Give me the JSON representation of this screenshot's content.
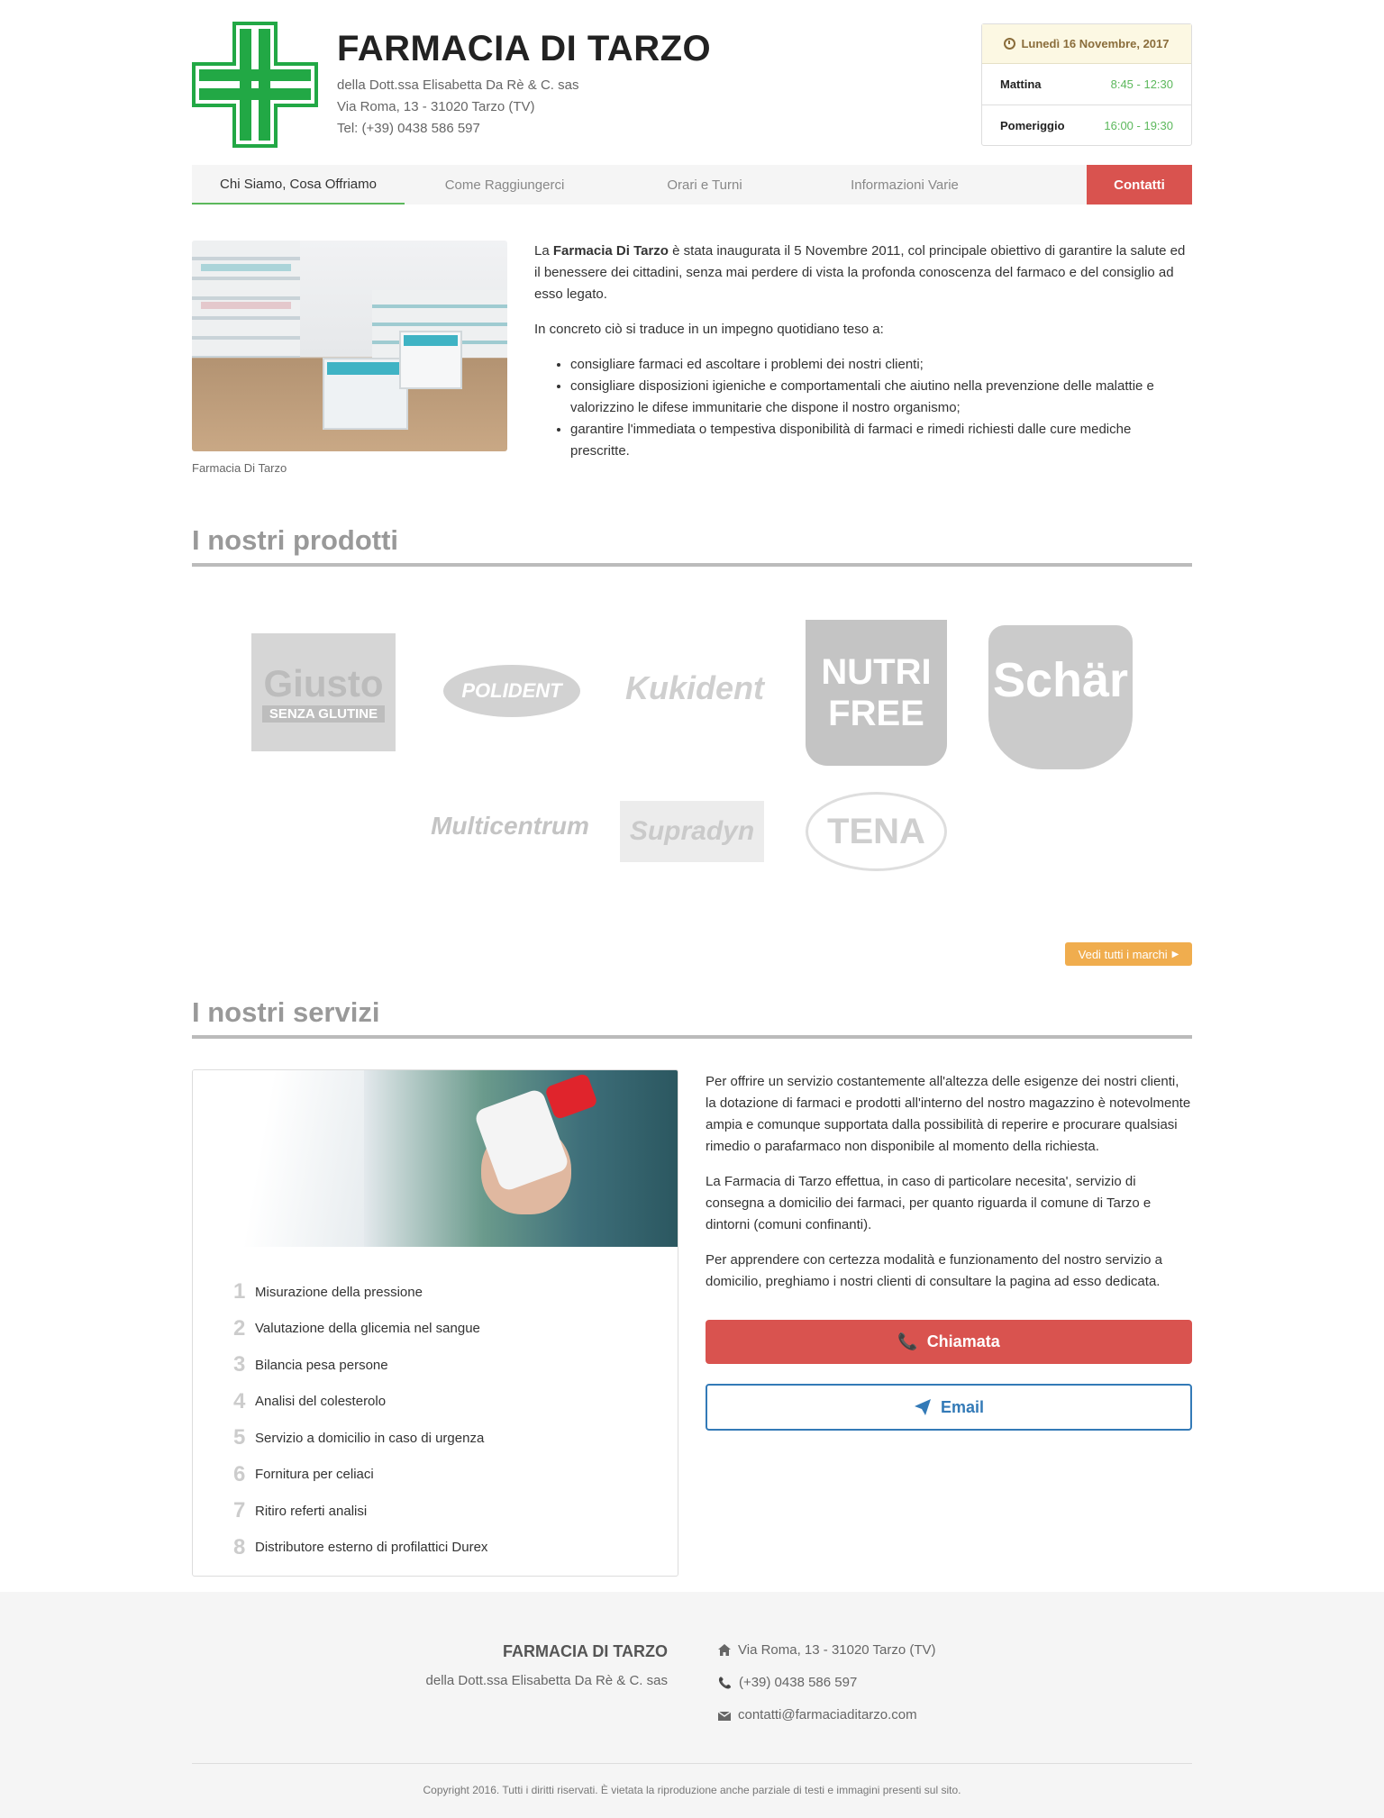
{
  "header": {
    "title": "FARMACIA DI TARZO",
    "subtitle": "della Dott.ssa Elisabetta Da Rè & C. sas",
    "address": "Via Roma, 13 - 31020 Tarzo (TV)",
    "phone": "Tel: (+39) 0438 586 597",
    "accent_color": "#22a845"
  },
  "hours": {
    "date": "Lunedì 16 Novembre, 2017",
    "rows": [
      {
        "label": "Mattina",
        "value": "8:45 - 12:30"
      },
      {
        "label": "Pomeriggio",
        "value": "16:00 - 19:30"
      }
    ]
  },
  "nav": {
    "items": [
      {
        "label": "Chi Siamo, Cosa Offriamo"
      },
      {
        "label": "Come Raggiungerci"
      },
      {
        "label": "Orari e Turni"
      },
      {
        "label": "Informazioni Varie"
      }
    ],
    "cta": "Contatti"
  },
  "intro": {
    "caption": "Farmacia Di Tarzo",
    "p1_pre": "La ",
    "p1_bold": "Farmacia Di Tarzo",
    "p1_post": " è stata inaugurata il 5 Novembre 2011, col principale obiettivo di garantire la salute ed il benessere dei cittadini, senza mai perdere di vista la profonda conoscenza del farmaco e del consiglio ad esso legato.",
    "p2": "In concreto ciò si traduce in un impegno quotidiano teso a:",
    "bullets": [
      "consigliare farmaci ed ascoltare i problemi dei nostri clienti;",
      "consigliare disposizioni igieniche e comportamentali che aiutino nella prevenzione delle malattie e valorizzino le difese immunitarie che dispone il nostro organismo;",
      "garantire l'immediata o tempestiva disponibilità di farmaci e rimedi richiesti dalle cure mediche prescritte."
    ]
  },
  "products": {
    "title": "I nostri prodotti",
    "brands": [
      {
        "name": "Giusto",
        "tag": "SENZA GLUTINE"
      },
      {
        "name": "POLIDENT"
      },
      {
        "name": "Kukident"
      },
      {
        "name": "NUTRI",
        "tag": "FREE"
      },
      {
        "name": "Schär"
      },
      {
        "name": "Multicentrum"
      },
      {
        "name": "Supradyn"
      },
      {
        "name": "TENA"
      }
    ],
    "more_label": "Vedi tutti i marchi"
  },
  "services": {
    "title": "I nostri servizi",
    "items": [
      {
        "num": "1",
        "label": "Misurazione della pressione"
      },
      {
        "num": "2",
        "label": "Valutazione della glicemia nel sangue"
      },
      {
        "num": "3",
        "label": "Bilancia pesa persone"
      },
      {
        "num": "4",
        "label": "Analisi del colesterolo"
      },
      {
        "num": "5",
        "label": "Servizio a domicilio in caso di urgenza"
      },
      {
        "num": "6",
        "label": "Fornitura per celiaci"
      },
      {
        "num": "7",
        "label": "Ritiro referti analisi"
      },
      {
        "num": "8",
        "label": "Distributore esterno di profilattici Durex"
      }
    ],
    "paragraphs": [
      "Per offrire un servizio costantemente all'altezza delle esigenze dei nostri clienti, la dotazione di farmaci e prodotti all'interno del nostro magazzino è notevolmente ampia e comunque supportata dalla possibilità di reperire e procurare qualsiasi rimedio o parafarmaco non disponibile al momento della richiesta.",
      "La Farmacia di Tarzo effettua, in caso di particolare necesita', servizio di consegna a domicilio dei farmaci, per quanto riguarda il comune di Tarzo e dintorni (comuni confinanti).",
      "Per apprendere con certezza modalità e funzionamento del nostro servizio a domicilio, preghiamo i nostri clienti di consultare la pagina ad esso dedicata."
    ],
    "call_label": "Chiamata",
    "email_label": "Email"
  },
  "footer": {
    "name": "FARMACIA DI TARZO",
    "sub": "della Dott.ssa Elisabetta Da Rè & C. sas",
    "address": "Via Roma, 13 - 31020 Tarzo (TV)",
    "phone": "(+39) 0438 586 597",
    "email": "contatti@farmaciaditarzo.com",
    "copyright": "Copyright 2016. Tutti i diritti riservati. È vietata la riproduzione anche parziale di testi e immagini presenti sul sito."
  }
}
